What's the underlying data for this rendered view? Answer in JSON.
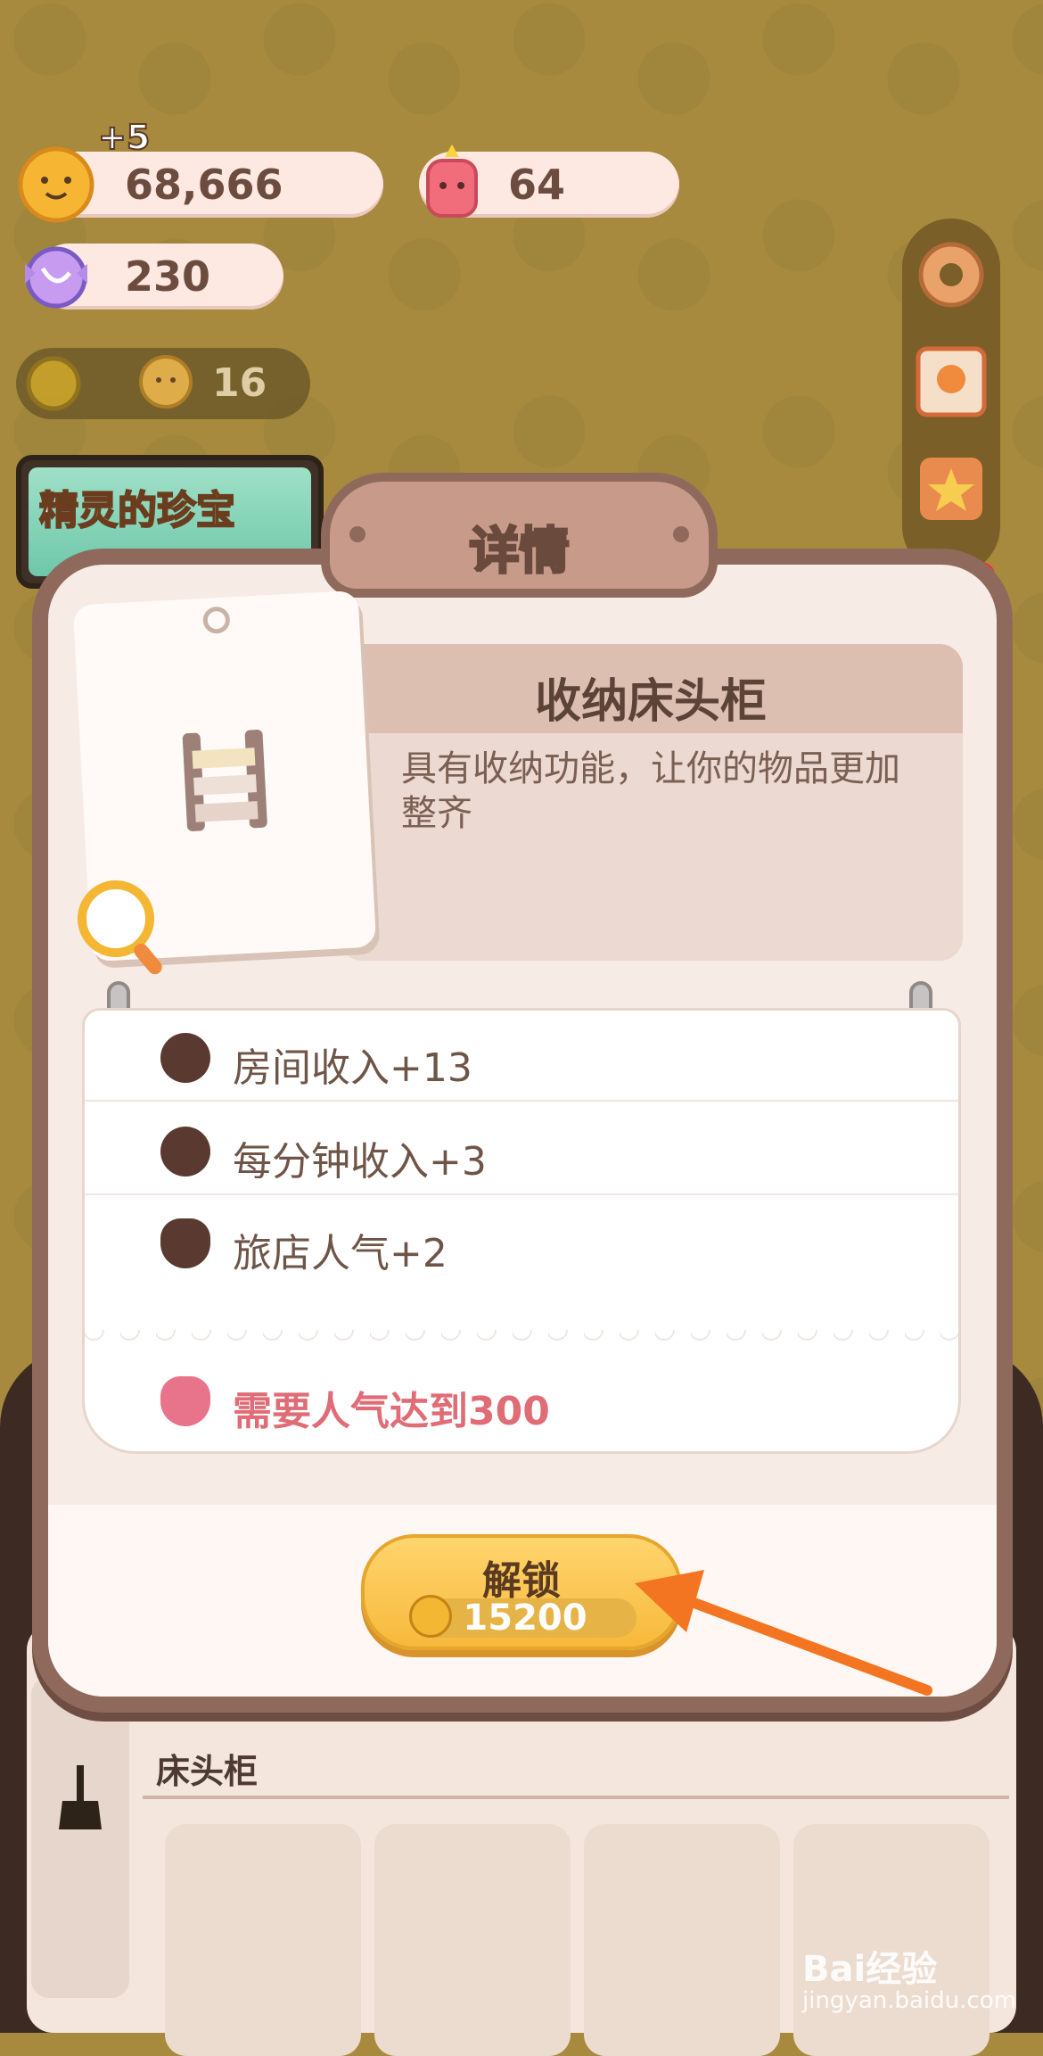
{
  "resources": {
    "coins": {
      "value": "68,666",
      "bonus": "+5",
      "icon": "cookie-coin-icon"
    },
    "candles": {
      "value": "64",
      "icon": "pink-candle-icon"
    },
    "candy": {
      "value": "230",
      "icon": "candy-icon"
    },
    "guests": {
      "value": "16",
      "icon": "guest-icon"
    }
  },
  "banner": {
    "text": "精灵的珍宝"
  },
  "modal": {
    "title": "详情",
    "item_name": "收纳床头柜",
    "item_desc": "具有收纳功能，让你的物品更加整齐",
    "stats": [
      {
        "label": "房间收入+13",
        "icon": "cookie-icon"
      },
      {
        "label": "每分钟收入+3",
        "icon": "cookie-icon"
      },
      {
        "label": "旅店人气+2",
        "icon": "popularity-icon"
      }
    ],
    "requirement": {
      "label": "需要人气达到300",
      "icon": "popularity-icon"
    },
    "unlock": {
      "label": "解锁",
      "price": "15200"
    }
  },
  "bottom": {
    "category_title": "床头柜"
  },
  "watermark": {
    "brand": "Bai经验",
    "url": "jingyan.baidu.com"
  },
  "colors": {
    "accent": "#f7b93c",
    "frame": "#8f6a5c",
    "requirement": "#e06c76",
    "arrow": "#f37521"
  }
}
